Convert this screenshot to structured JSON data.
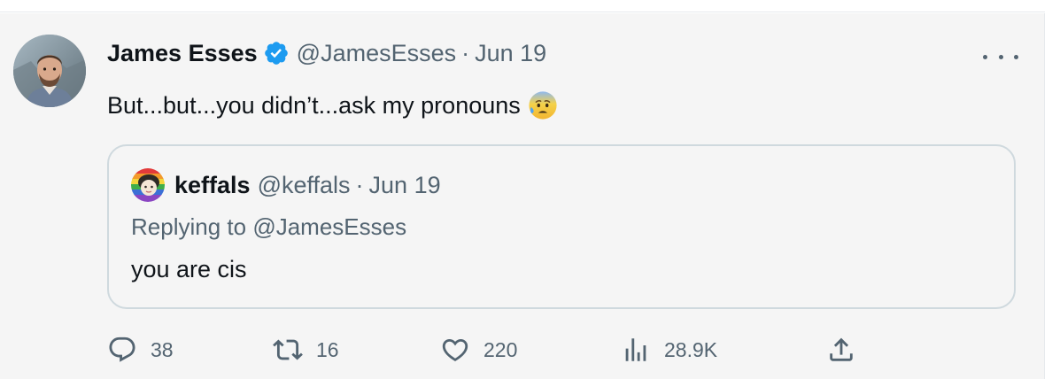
{
  "tweet": {
    "author_name": "James Esses",
    "author_handle": "@JamesEsses",
    "separator": "·",
    "date": "Jun 19",
    "text": "But...but...you didn’t...ask my pronouns",
    "emoji": "anxious-face-with-sweat-icon"
  },
  "quote": {
    "author_name": "keffals",
    "author_handle": "@keffals",
    "separator": "·",
    "date": "Jun 19",
    "replying_prefix": "Replying to ",
    "replying_to": "@JamesEsses",
    "text": "you are cis"
  },
  "actions": {
    "replies": "38",
    "retweets": "16",
    "likes": "220",
    "views": "28.9K"
  },
  "colors": {
    "background": "#f5f5f5",
    "text_primary": "#0f1419",
    "text_secondary": "#536471",
    "verified": "#1d9bf0",
    "border": "#cfd9de"
  }
}
